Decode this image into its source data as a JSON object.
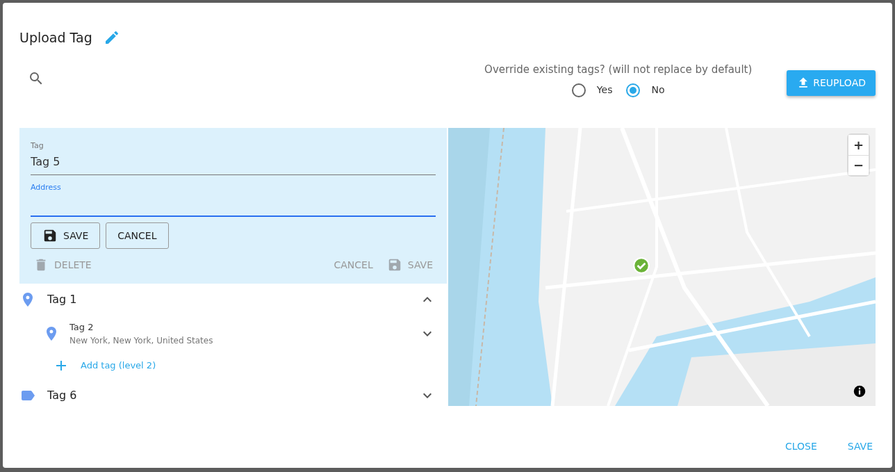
{
  "dialog": {
    "title": "Upload Tag"
  },
  "override": {
    "question": "Override existing tags? (will not replace by default)",
    "options": [
      {
        "label": "Yes",
        "selected": false
      },
      {
        "label": "No",
        "selected": true
      }
    ]
  },
  "reupload_button": "REUPLOAD",
  "editor": {
    "fields": [
      {
        "label": "Tag",
        "value": "Tag 5",
        "focused": false
      },
      {
        "label": "Address",
        "focused": true
      }
    ],
    "buttons": [
      {
        "label": "SAVE",
        "kind": "save"
      },
      {
        "label": "CANCEL",
        "kind": "plain"
      }
    ],
    "actions": [
      {
        "label": "DELETE",
        "kind": "delete",
        "disabled": true
      },
      {
        "label": "CANCEL",
        "kind": "plain",
        "disabled": true
      },
      {
        "label": "SAVE",
        "kind": "save",
        "disabled": true
      }
    ]
  },
  "tree": [
    {
      "label": "Tag 1",
      "kind": "location",
      "expanded": true,
      "add_label": "Add tag (level 2)",
      "children": [
        {
          "label": "Tag 2",
          "subtitle": "New York, New York, United States",
          "kind": "location",
          "expanded": false
        }
      ]
    },
    {
      "label": "Tag 6",
      "kind": "label",
      "expanded": false
    }
  ],
  "map": {
    "kind": "picture",
    "zoom_in": "+",
    "zoom_out": "−"
  },
  "footer": [
    "CLOSE",
    "SAVE"
  ]
}
